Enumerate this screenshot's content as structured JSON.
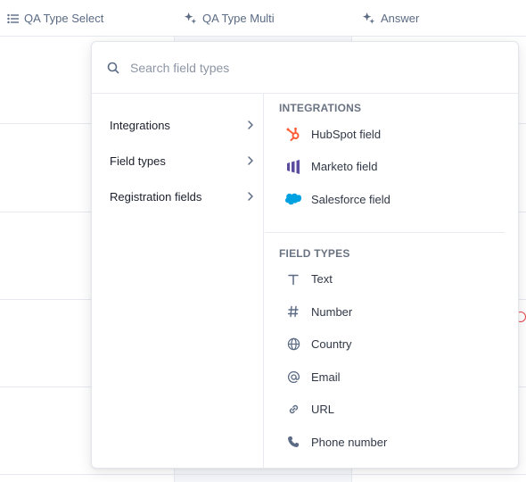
{
  "table": {
    "columns": [
      {
        "label": "QA Type Select",
        "icon": "list-icon"
      },
      {
        "label": "QA Type Multi",
        "icon": "sparkle-icon"
      },
      {
        "label": "Answer",
        "icon": "sparkle-icon"
      }
    ]
  },
  "search": {
    "placeholder": "Search field types"
  },
  "categories": [
    {
      "label": "Integrations"
    },
    {
      "label": "Field types"
    },
    {
      "label": "Registration fields"
    }
  ],
  "sections": {
    "integrations": {
      "title": "INTEGRATIONS",
      "items": [
        {
          "label": "HubSpot field",
          "icon": "hubspot-icon",
          "color": "#ff5c35"
        },
        {
          "label": "Marketo field",
          "icon": "marketo-icon",
          "color": "#5c4c9f"
        },
        {
          "label": "Salesforce field",
          "icon": "salesforce-icon",
          "color": "#00a1e0"
        }
      ]
    },
    "field_types": {
      "title": "FIELD TYPES",
      "items": [
        {
          "label": "Text",
          "icon": "text-icon"
        },
        {
          "label": "Number",
          "icon": "hash-icon"
        },
        {
          "label": "Country",
          "icon": "globe-icon"
        },
        {
          "label": "Email",
          "icon": "at-icon"
        },
        {
          "label": "URL",
          "icon": "link-icon"
        },
        {
          "label": "Phone number",
          "icon": "phone-icon"
        }
      ]
    }
  }
}
